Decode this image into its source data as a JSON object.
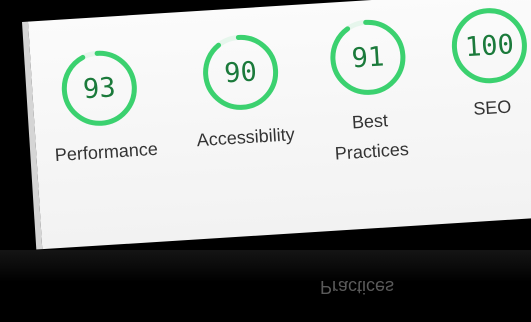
{
  "colors": {
    "accent": "#3bd16f",
    "score_text": "#1b7a3b",
    "track": "#e6f6ec"
  },
  "categories": [
    {
      "id": "performance",
      "label": "Performance",
      "score": "93",
      "fraction": 0.93
    },
    {
      "id": "accessibility",
      "label": "Accessibility",
      "score": "90",
      "fraction": 0.9
    },
    {
      "id": "best-practices",
      "label_line1": "Best",
      "label_line2": "Practices",
      "score": "91",
      "fraction": 0.91
    },
    {
      "id": "seo",
      "label": "SEO",
      "score": "100",
      "fraction": 1.0
    }
  ],
  "reflection": {
    "text": "Practices"
  }
}
